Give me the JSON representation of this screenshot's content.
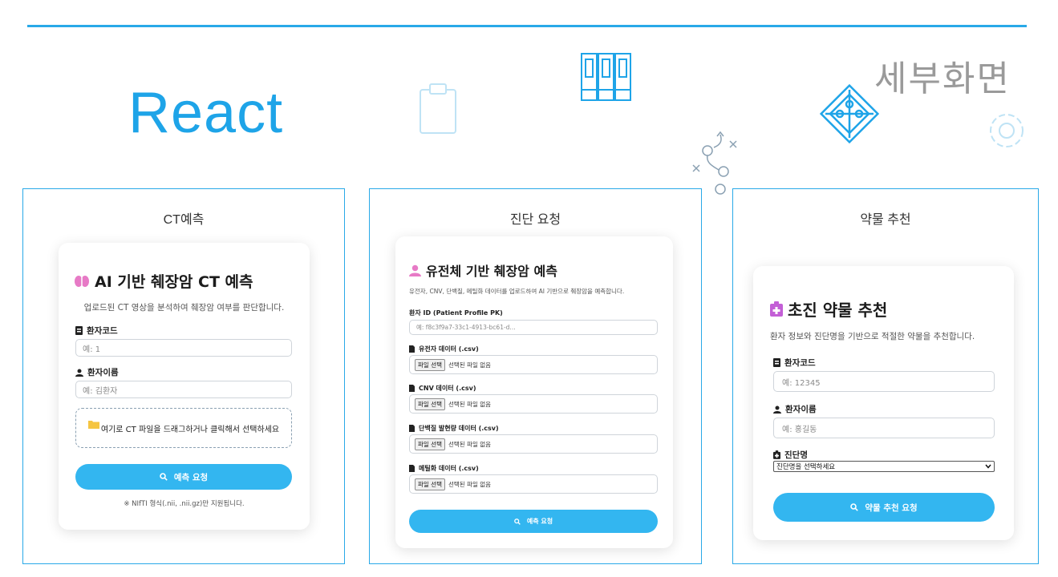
{
  "header": {
    "title": "React",
    "subtitle": "세부화면",
    "accent_color": "#29a9e8"
  },
  "icons": [
    "clipboard-icon",
    "books-icon",
    "puzzle-icon",
    "gear-icon",
    "path-icon"
  ],
  "panels": [
    {
      "title": "CT예측",
      "card": {
        "heading": "AI 기반 췌장암 CT 예측",
        "heading_icon": "brain-icon",
        "description": "업로드된 CT 영상을 분석하여 췌장암 여부를 판단합니다.",
        "fields": [
          {
            "label": "환자코드",
            "icon": "id-card-icon",
            "placeholder": "예: 1"
          },
          {
            "label": "환자이름",
            "icon": "user-icon",
            "placeholder": "예: 김환자"
          }
        ],
        "dropzone_text": "여기로 CT 파일을 드래그하거나 클릭해서 선택하세요",
        "button_label": "예측 요청",
        "note": "※ NIfTI 형식(.nii, .nii.gz)만 지원됩니다."
      }
    },
    {
      "title": "진단 요청",
      "card": {
        "heading": "유전체 기반 췌장암 예측",
        "heading_icon": "user-icon",
        "description": "유전자, CNV, 단백질, 메틸화 데이터를 업로드하여 AI 기반으로 췌장암을 예측합니다.",
        "id_label": "환자 ID (Patient Profile PK)",
        "id_placeholder": "예: f8c3f9a7-33c1-4913-bc61-d...",
        "file_button": "파일 선택",
        "no_file": "선택된 파일 없음",
        "files": [
          {
            "label": "유전자 데이터 (.csv)",
            "icon": "file-icon"
          },
          {
            "label": "CNV 데이터 (.csv)",
            "icon": "file-icon"
          },
          {
            "label": "단백질 발현량 데이터 (.csv)",
            "icon": "file-icon"
          },
          {
            "label": "메틸화 데이터 (.csv)",
            "icon": "file-icon"
          }
        ],
        "button_label": "예측 요청"
      }
    },
    {
      "title": "약물 추천",
      "card": {
        "heading": "초진 약물 추천",
        "heading_icon": "medkit-icon",
        "description": "환자 정보와 진단명을 기반으로 적절한 약물을 추천합니다.",
        "fields": [
          {
            "label": "환자코드",
            "icon": "id-card-icon",
            "placeholder": "예: 12345"
          },
          {
            "label": "환자이름",
            "icon": "user-icon",
            "placeholder": "예: 홍길동"
          }
        ],
        "select_label": "진단명",
        "select_icon": "medkit-icon",
        "select_value": "진단명을 선택하세요",
        "button_label": "약물 추천 요청"
      }
    }
  ]
}
